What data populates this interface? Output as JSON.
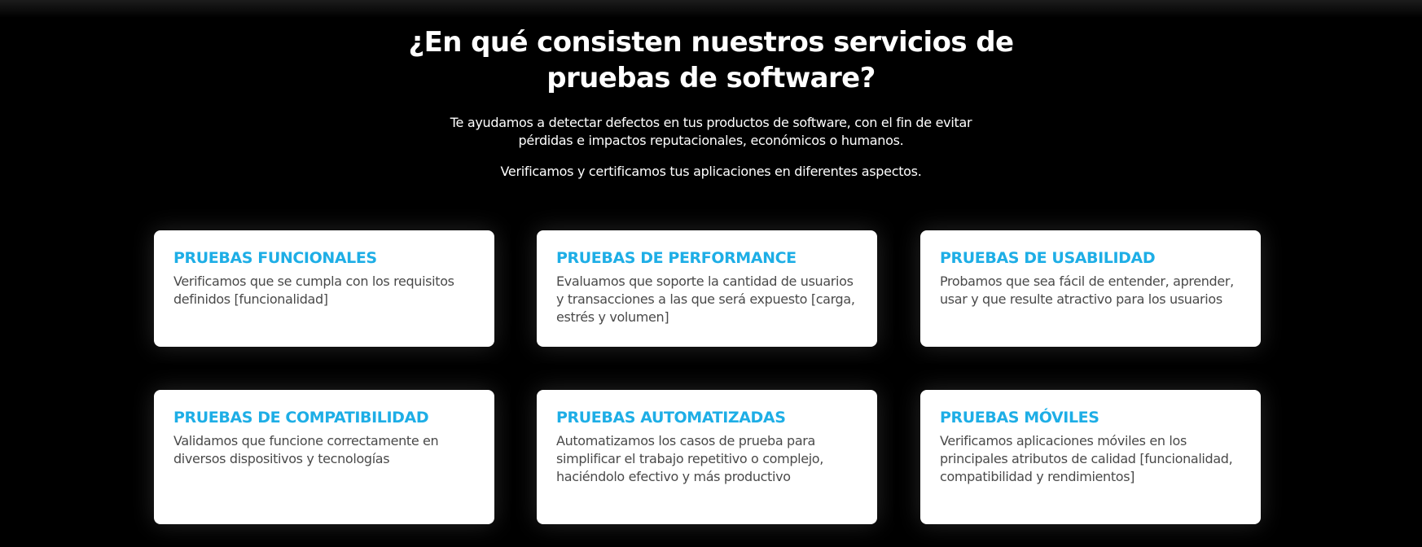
{
  "section": {
    "title": "¿En qué consisten nuestros servicios de pruebas de software?",
    "intro": "Te ayudamos a detectar defectos en tus productos de software, con el fin de evitar pérdidas e impactos reputacionales, económicos o humanos.",
    "intro_2": "Verificamos y certificamos tus aplicaciones en diferentes aspectos."
  },
  "colors": {
    "background": "#000000",
    "card_background": "#ffffff",
    "card_title": "#1eaee6",
    "card_text": "#4a4a4a"
  },
  "services": [
    {
      "title": "PRUEBAS FUNCIONALES",
      "description": "Verificamos que se cumpla con los requisitos definidos [funcionalidad]"
    },
    {
      "title": "PRUEBAS DE PERFORMANCE",
      "description": "Evaluamos que soporte la cantidad de usuarios y transacciones a las que será expuesto [carga, estrés y volumen]"
    },
    {
      "title": "PRUEBAS DE USABILIDAD",
      "description": "Probamos que sea fácil de entender, aprender, usar y que resulte atractivo para los usuarios"
    },
    {
      "title": "PRUEBAS DE COMPATIBILIDAD",
      "description": "Validamos que funcione correctamente en diversos dispositivos y tecnologías"
    },
    {
      "title": "PRUEBAS AUTOMATIZADAS",
      "description": "Automatizamos los casos de prueba para simplificar el trabajo repetitivo o complejo, haciéndolo efectivo y más productivo"
    },
    {
      "title": "PRUEBAS MÓVILES",
      "description": "Verificamos aplicaciones móviles en los principales atributos de calidad [funcionalidad, compatibilidad y rendimientos]"
    }
  ]
}
